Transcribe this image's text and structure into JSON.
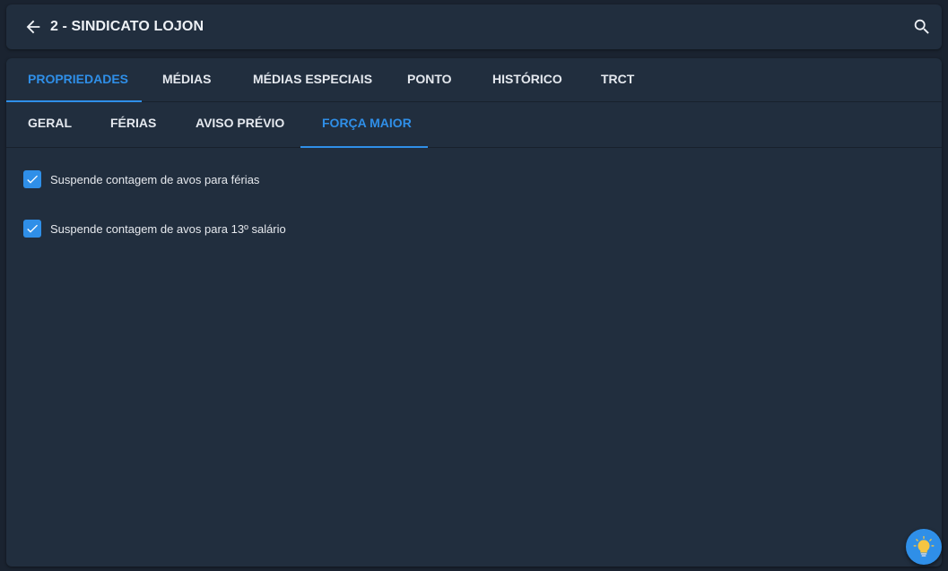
{
  "header": {
    "title": "2 - SINDICATO LOJON",
    "back_icon": "arrow-left-icon",
    "search_icon": "search-icon"
  },
  "tabs": [
    {
      "label": "PROPRIEDADES",
      "active": true
    },
    {
      "label": "MÉDIAS",
      "active": false
    },
    {
      "label": "MÉDIAS ESPECIAIS",
      "active": false
    },
    {
      "label": "PONTO",
      "active": false
    },
    {
      "label": "HISTÓRICO",
      "active": false
    },
    {
      "label": "TRCT",
      "active": false
    }
  ],
  "subtabs": [
    {
      "label": "GERAL",
      "active": false
    },
    {
      "label": "FÉRIAS",
      "active": false
    },
    {
      "label": "AVISO PRÉVIO",
      "active": false
    },
    {
      "label": "FORÇA MAIOR",
      "active": true
    }
  ],
  "options": [
    {
      "label": "Suspende contagem de avos para férias",
      "checked": true
    },
    {
      "label": "Suspende contagem de avos para 13º salário",
      "checked": true
    }
  ],
  "fab": {
    "icon": "lightbulb-icon"
  },
  "colors": {
    "accent": "#2f8fe8",
    "surface": "#212e3e",
    "background": "#1a2330"
  }
}
